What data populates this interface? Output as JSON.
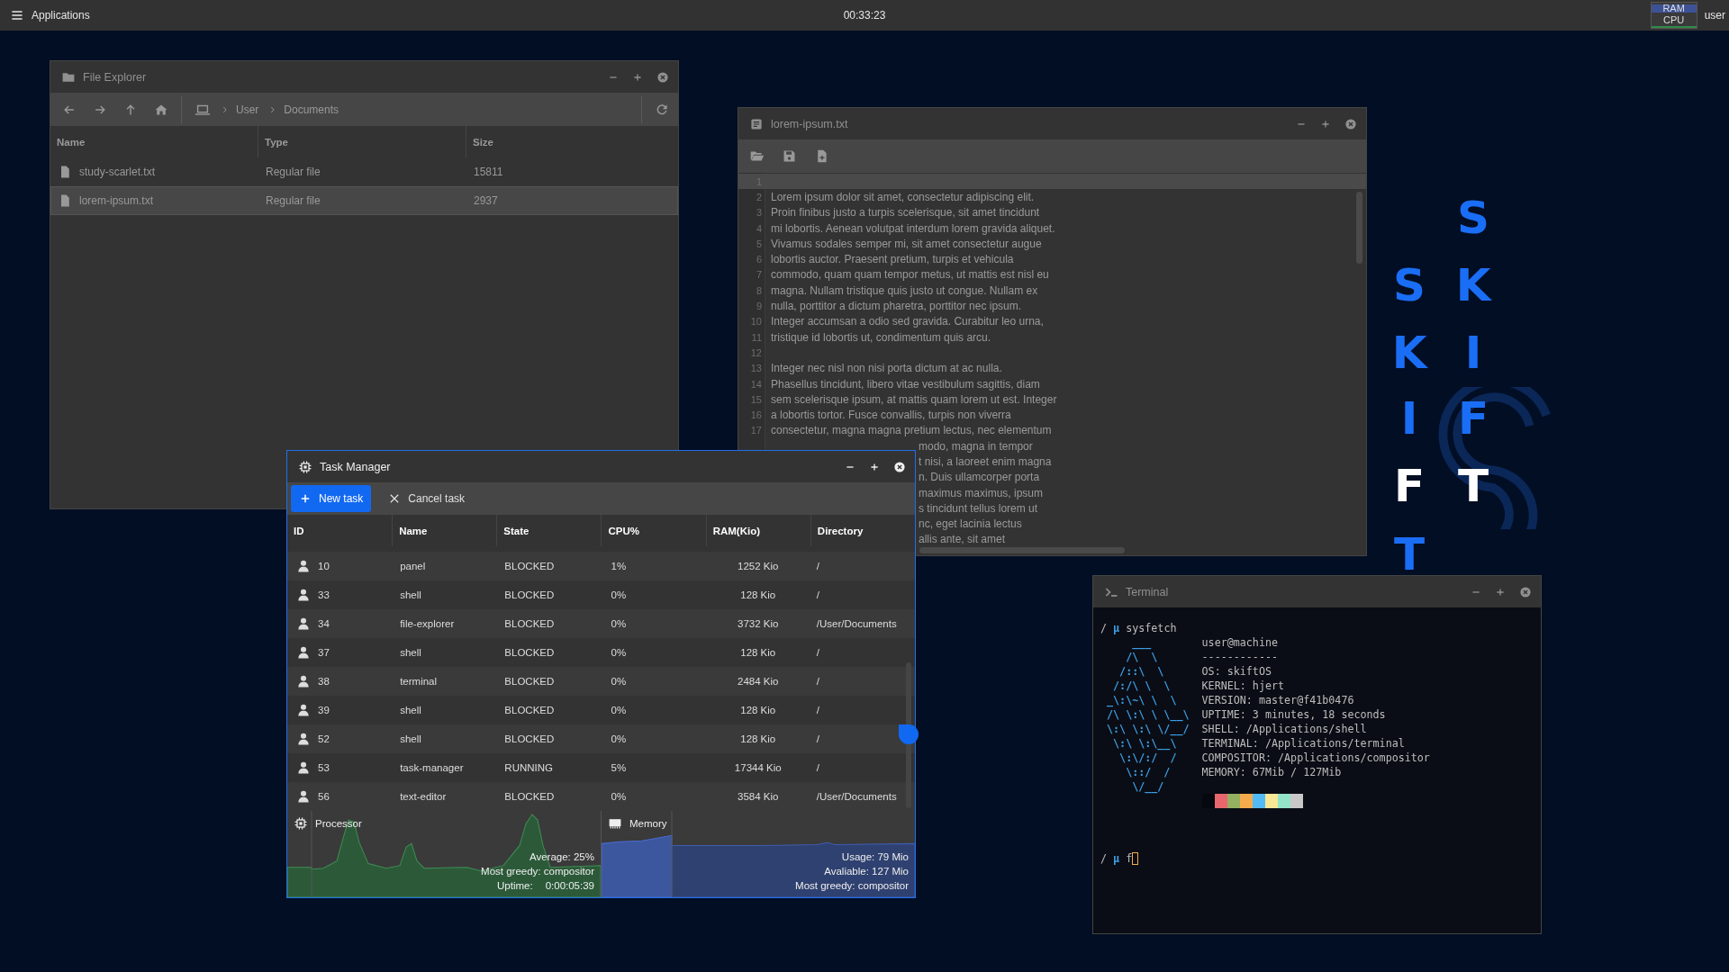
{
  "top_bar": {
    "menu_label": "Applications",
    "clock": "00:33:23",
    "ram_label": "RAM",
    "cpu_label": "CPU",
    "user": "user"
  },
  "wallpaper": {
    "letters": [
      {
        "char": "S",
        "color": "#1a6ef5"
      },
      {
        "char": "S",
        "color": "#1a6ef5"
      },
      {
        "char": "K",
        "color": "#1a6ef5"
      },
      {
        "char": "K",
        "color": "#1a6ef5"
      },
      {
        "char": "I",
        "color": "#1a6ef5"
      },
      {
        "char": "I",
        "color": "#1a6ef5"
      },
      {
        "char": "F",
        "color": "#1a6ef5"
      },
      {
        "char": "F",
        "color": "#ffffff"
      },
      {
        "char": "T",
        "color": "#ffffff"
      },
      {
        "char": "T",
        "color": "#1a6ef5"
      }
    ]
  },
  "file_explorer": {
    "title": "File Explorer",
    "focused": false,
    "breadcrumb": [
      "User",
      "Documents"
    ],
    "columns": [
      "Name",
      "Type",
      "Size"
    ],
    "rows": [
      {
        "name": "study-scarlet.txt",
        "type": "Regular file",
        "size": "15811",
        "selected": false
      },
      {
        "name": "lorem-ipsum.txt",
        "type": "Regular file",
        "size": "2937",
        "selected": true
      }
    ]
  },
  "text_editor": {
    "title": "lorem-ipsum.txt",
    "focused": false,
    "lines": [
      {
        "kind": "full",
        "number": "1",
        "current": true
      },
      {
        "kind": "full",
        "number": "2",
        "text": "Lorem ipsum dolor sit amet, consectetur adipiscing elit.",
        "current": false
      },
      {
        "kind": "full",
        "number": "3",
        "text": "Proin finibus justo a turpis scelerisque, sit amet tincidunt",
        "current": false
      },
      {
        "kind": "full",
        "number": "4",
        "text": "mi lobortis. Aenean volutpat interdum lorem gravida aliquet.",
        "current": false
      },
      {
        "kind": "full",
        "number": "5",
        "text": "Vivamus sodales semper mi, sit amet consectetur augue",
        "current": false
      },
      {
        "kind": "full",
        "number": "6",
        "text": "lobortis auctor. Praesent pretium, turpis et vehicula",
        "current": false
      },
      {
        "kind": "full",
        "number": "7",
        "text": "commodo, quam quam tempor metus, ut mattis est nisl eu",
        "current": false
      },
      {
        "kind": "full",
        "number": "8",
        "text": "magna. Nullam tristique quis justo ut congue. Nullam ex",
        "current": false
      },
      {
        "kind": "full",
        "number": "9",
        "text": "nulla, porttitor a dictum pharetra, porttitor nec ipsum.",
        "current": false
      },
      {
        "kind": "full",
        "number": "10",
        "text": "Integer accumsan a odio sed gravida. Curabitur leo urna,",
        "current": false
      },
      {
        "kind": "full",
        "number": "11",
        "text": "tristique id lobortis ut, condimentum quis arcu.",
        "current": false
      },
      {
        "kind": "full",
        "number": "12",
        "current": false
      },
      {
        "kind": "full",
        "number": "13",
        "text": "Integer nec nisl non nisi porta dictum at ac nulla.",
        "current": false
      },
      {
        "kind": "full",
        "number": "14",
        "text": "Phasellus tincidunt, libero vitae vestibulum sagittis, diam",
        "current": false
      },
      {
        "kind": "full",
        "number": "15",
        "text": "sem scelerisque ipsum, at mattis quam lorem ut est. Integer",
        "current": false
      },
      {
        "kind": "full",
        "number": "16",
        "text": "a lobortis tortor. Fusce convallis, turpis non viverra",
        "current": false
      },
      {
        "kind": "full",
        "number": "17",
        "text": "consectetur, magna magna pretium lectus, nec elementum",
        "current": false
      },
      {
        "kind": "covered",
        "text": "modo, magna in tempor"
      },
      {
        "kind": "covered",
        "text": "t nisi, a laoreet enim magna"
      },
      {
        "kind": "covered",
        "text": "n. Duis ullamcorper porta"
      },
      {
        "kind": "covered",
        "text": "maximus maximus, ipsum"
      },
      {
        "kind": "covered",
        "text": "s tincidunt tellus lorem ut"
      },
      {
        "kind": "covered",
        "text": "nc, eget lacinia lectus"
      },
      {
        "kind": "covered",
        "text": "allis ante, sit amet"
      }
    ]
  },
  "terminal": {
    "title": "Terminal",
    "focused": false,
    "prompts": [
      {
        "path": "/",
        "symbol": "μ",
        "command": "sysfetch",
        "active": false
      },
      {
        "path": "/",
        "symbol": "μ",
        "command": "f",
        "active": true
      }
    ],
    "art": [
      "    ___",
      "   /\\  \\",
      "  /::\\  \\",
      " /:/\\ \\  \\",
      "_\\:\\~\\ \\  \\",
      "/\\ \\:\\ \\ \\__\\",
      "\\:\\ \\:\\ \\/__/",
      " \\:\\ \\:\\__\\",
      "  \\:\\/:/  /",
      "   \\::/  /",
      "    \\/__/"
    ],
    "info": [
      "user@machine",
      "------------",
      "OS: skiftOS",
      "KERNEL: hjert",
      "VERSION: master@f41b0476",
      "UPTIME: 3 minutes, 18 seconds",
      "SHELL: /Applications/shell",
      "TERMINAL: /Applications/terminal",
      "COMPOSITOR: /Applications/compositor",
      "MEMORY: 67Mib / 127Mib"
    ],
    "palette": [
      {
        "color": "#05080e"
      },
      {
        "color": "#e8676e"
      },
      {
        "color": "#94b060"
      },
      {
        "color": "#f6ab4c"
      },
      {
        "color": "#52bbf5"
      },
      {
        "color": "#f8e795"
      },
      {
        "color": "#93e3c8"
      },
      {
        "color": "#c8c8c8"
      }
    ]
  },
  "task_manager": {
    "title": "Task Manager",
    "focused": true,
    "buttons": [
      {
        "label": "New task",
        "kind": "primary"
      },
      {
        "label": "Cancel task",
        "kind": "plain"
      }
    ],
    "columns": [
      "ID",
      "Name",
      "State",
      "CPU%",
      "RAM(Kio)",
      "Directory"
    ],
    "rows": [
      {
        "id": "10",
        "name": "panel",
        "state": "BLOCKED",
        "cpu": "1%",
        "ram": "1252 Kio",
        "directory": "/"
      },
      {
        "id": "33",
        "name": "shell",
        "state": "BLOCKED",
        "cpu": "0%",
        "ram": "128 Kio",
        "directory": "/"
      },
      {
        "id": "34",
        "name": "file-explorer",
        "state": "BLOCKED",
        "cpu": "0%",
        "ram": "3732 Kio",
        "directory": "/User/Documents"
      },
      {
        "id": "37",
        "name": "shell",
        "state": "BLOCKED",
        "cpu": "0%",
        "ram": "128 Kio",
        "directory": "/"
      },
      {
        "id": "38",
        "name": "terminal",
        "state": "BLOCKED",
        "cpu": "0%",
        "ram": "2484 Kio",
        "directory": "/"
      },
      {
        "id": "39",
        "name": "shell",
        "state": "BLOCKED",
        "cpu": "0%",
        "ram": "128 Kio",
        "directory": "/"
      },
      {
        "id": "52",
        "name": "shell",
        "state": "BLOCKED",
        "cpu": "0%",
        "ram": "128 Kio",
        "directory": "/"
      },
      {
        "id": "53",
        "name": "task-manager",
        "state": "RUNNING",
        "cpu": "5%",
        "ram": "17344 Kio",
        "directory": "/"
      },
      {
        "id": "56",
        "name": "text-editor",
        "state": "BLOCKED",
        "cpu": "0%",
        "ram": "3584 Kio",
        "directory": "/User/Documents"
      }
    ],
    "processor": {
      "label": "Processor",
      "average": "Average: 25%",
      "greedy": "Most greedy: compositor",
      "uptime_label": "Uptime:",
      "uptime": "0:00:05:39"
    },
    "memory": {
      "label": "Memory",
      "usage": "Usage: 79 Mio",
      "available": "Avaliable: 127 Mio",
      "greedy": "Most greedy: compositor"
    }
  }
}
